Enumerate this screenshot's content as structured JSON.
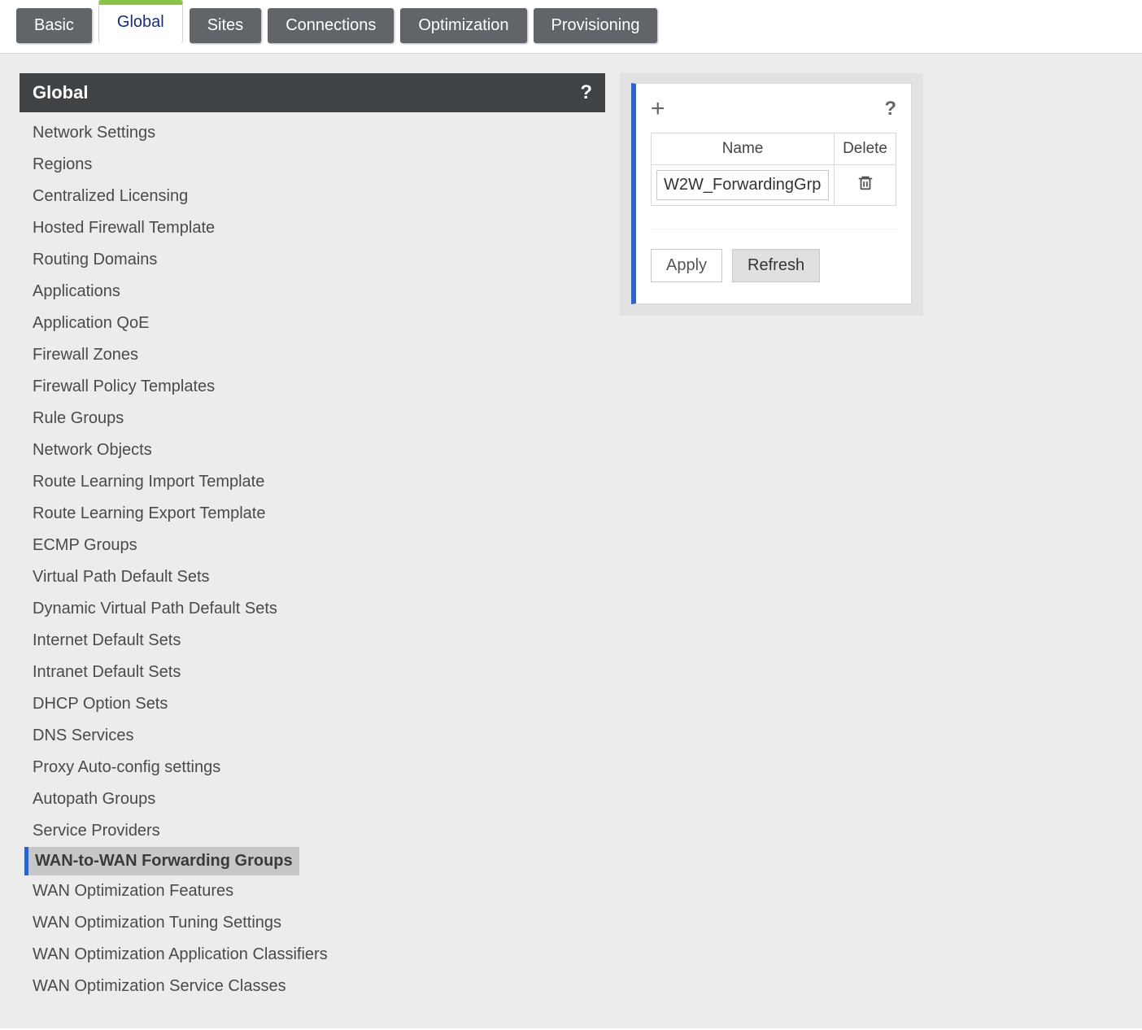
{
  "tabs": [
    {
      "label": "Basic",
      "active": false
    },
    {
      "label": "Global",
      "active": true
    },
    {
      "label": "Sites",
      "active": false
    },
    {
      "label": "Connections",
      "active": false
    },
    {
      "label": "Optimization",
      "active": false
    },
    {
      "label": "Provisioning",
      "active": false
    }
  ],
  "left_panel": {
    "title": "Global",
    "help": "?",
    "items": [
      "Network Settings",
      "Regions",
      "Centralized Licensing",
      "Hosted Firewall Template",
      "Routing Domains",
      "Applications",
      "Application QoE",
      "Firewall Zones",
      "Firewall Policy Templates",
      "Rule Groups",
      "Network Objects",
      "Route Learning Import Template",
      "Route Learning Export Template",
      "ECMP Groups",
      "Virtual Path Default Sets",
      "Dynamic Virtual Path Default Sets",
      "Internet Default Sets",
      "Intranet Default Sets",
      "DHCP Option Sets",
      "DNS Services",
      "Proxy Auto-config settings",
      "Autopath Groups",
      "Service Providers",
      "WAN-to-WAN Forwarding Groups",
      "WAN Optimization Features",
      "WAN Optimization Tuning Settings",
      "WAN Optimization Application Classifiers",
      "WAN Optimization Service Classes"
    ],
    "selected_index": 23
  },
  "right_panel": {
    "add": "+",
    "help": "?",
    "columns": {
      "name": "Name",
      "delete": "Delete"
    },
    "rows": [
      {
        "name": "W2W_ForwardingGrp"
      }
    ],
    "apply_label": "Apply",
    "refresh_label": "Refresh"
  }
}
